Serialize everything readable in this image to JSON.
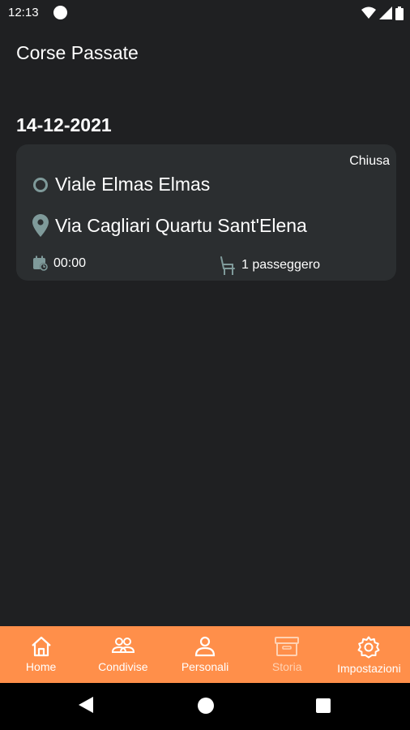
{
  "status_bar": {
    "time": "12:13"
  },
  "header": {
    "title": "Corse Passate"
  },
  "rides": [
    {
      "date": "14-12-2021",
      "status": "Chiusa",
      "from": "Viale Elmas Elmas",
      "to": "Via Cagliari Quartu Sant'Elena",
      "time": "00:00",
      "passengers": "1 passeggero"
    }
  ],
  "bottom_nav": {
    "items": [
      {
        "label": "Home",
        "icon": "home-icon"
      },
      {
        "label": "Condivise",
        "icon": "group-icon"
      },
      {
        "label": "Personali",
        "icon": "person-icon"
      },
      {
        "label": "Storia",
        "icon": "archive-icon"
      },
      {
        "label": "Impostazioni",
        "icon": "gear-icon"
      }
    ]
  },
  "colors": {
    "background": "#1f2022",
    "card": "#2b2e30",
    "accent": "#ff8f4a",
    "icon_muted": "#7f9a9a"
  }
}
